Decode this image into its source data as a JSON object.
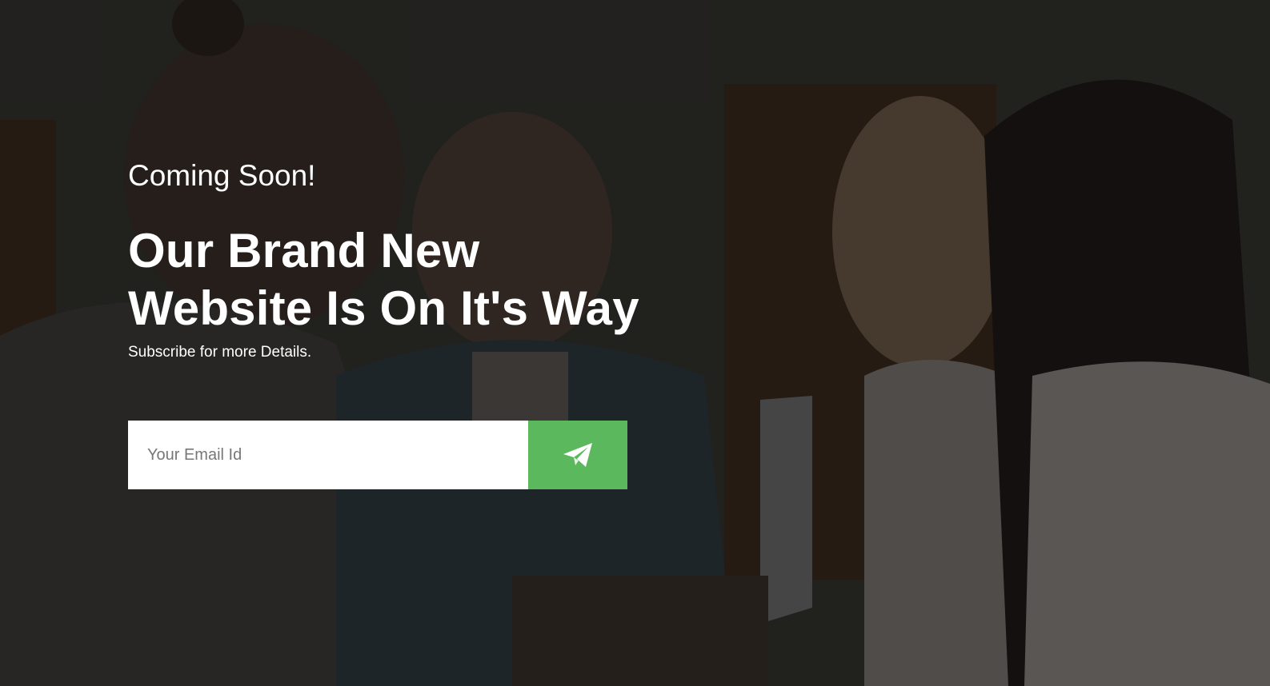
{
  "hero": {
    "eyebrow": "Coming Soon!",
    "headline_line1": "Our Brand New",
    "headline_line2": "Website Is On It's Way",
    "subtitle": "Subscribe for more Details."
  },
  "subscribe_form": {
    "email_placeholder": "Your Email Id",
    "email_value": "",
    "submit_icon": "paper-plane-icon"
  },
  "colors": {
    "accent": "#5cb85c",
    "text": "#ffffff",
    "input_background": "#ffffff"
  }
}
